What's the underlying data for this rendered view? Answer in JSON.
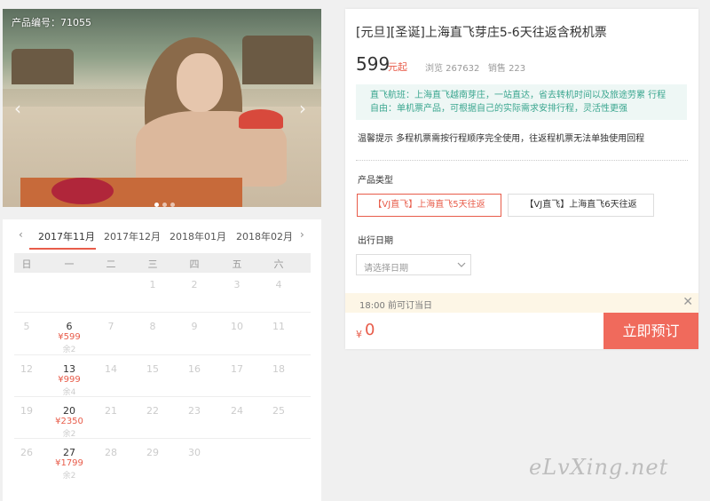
{
  "photo": {
    "product_id_label": "产品编号：71055",
    "prev_arrow": "‹",
    "next_arrow": "›"
  },
  "calendar": {
    "prev_label": "‹",
    "next_label": "›",
    "months": [
      "2017年11月",
      "2017年12月",
      "2018年01月",
      "2018年02月"
    ],
    "active_month": "2017年11月",
    "weekdays": [
      "日",
      "一",
      "二",
      "三",
      "四",
      "五",
      "六"
    ],
    "rows": [
      [
        "",
        "",
        "",
        "1",
        "2",
        "3",
        "4"
      ],
      [
        "5",
        "6",
        "7",
        "8",
        "9",
        "10",
        "11"
      ],
      [
        "12",
        "13",
        "14",
        "15",
        "16",
        "17",
        "18"
      ],
      [
        "19",
        "20",
        "21",
        "22",
        "23",
        "24",
        "25"
      ],
      [
        "26",
        "27",
        "28",
        "29",
        "30",
        "",
        ""
      ]
    ],
    "available": [
      {
        "day": "6",
        "price": "¥599",
        "stock": "余2"
      },
      {
        "day": "13",
        "price": "¥999",
        "stock": "余4"
      },
      {
        "day": "20",
        "price": "¥2350",
        "stock": "余2"
      },
      {
        "day": "27",
        "price": "¥1799",
        "stock": "余2"
      }
    ]
  },
  "product": {
    "title": "[元旦][圣诞]上海直飞芽庄5-6天往返含税机票",
    "price": "599",
    "price_unit": "元起",
    "stats": "浏览 267632   销售 223",
    "notice": "直飞航班：上海直飞越南芽庄，一站直达，省去转机时间以及旅途劳累 行程自由：单机票产品，可根据自己的实际需求安排行程，灵活性更强",
    "tip": "温馨提示 多程机票需按行程顺序完全使用，往返程机票无法单独使用回程",
    "type_label": "产品类型",
    "options": [
      "【VJ直飞】上海直飞5天往返",
      "【VJ直飞】上海直飞6天往返"
    ],
    "date_label": "出行日期",
    "date_placeholder": "请选择日期",
    "bar_text": "18:00 前可订当日",
    "close_glyph": "✕",
    "total_currency": "¥",
    "total": "0",
    "book_label": "立即预订"
  },
  "watermark": "eLvXing.net",
  "colors": {
    "accent": "#e85c4a",
    "book_button": "#f06a5c",
    "notice_bg": "#eef7f5",
    "notice_text": "#3aa68f",
    "bar_bg": "#fdf6e6"
  }
}
